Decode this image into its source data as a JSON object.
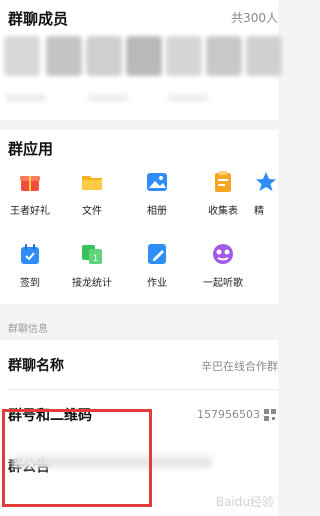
{
  "members": {
    "title": "群聊成员",
    "count": "共300人",
    "avatar_colors": [
      "#d8d8d8",
      "#c4c4c4",
      "#cfcfcf",
      "#b9b9b9",
      "#d6d6d6",
      "#c8c8c8",
      "#d0d0d0"
    ]
  },
  "apps": {
    "title": "群应用",
    "items": [
      {
        "label": "王者好礼",
        "icon": "gift-icon",
        "color": "#f24d3d"
      },
      {
        "label": "文件",
        "icon": "folder-icon",
        "color": "#f5b320"
      },
      {
        "label": "相册",
        "icon": "album-icon",
        "color": "#2f8ef5"
      },
      {
        "label": "收集表",
        "icon": "clipboard-icon",
        "color": "#f5a623"
      },
      {
        "label": "精",
        "icon": "star-icon",
        "color": "#2f8ef5"
      },
      {
        "label": "签到",
        "icon": "calendar-icon",
        "color": "#2f8ef5"
      },
      {
        "label": "接龙统计",
        "icon": "chain-icon",
        "color": "#39c25a"
      },
      {
        "label": "作业",
        "icon": "homework-icon",
        "color": "#2f8ef5"
      },
      {
        "label": "一起听歌",
        "icon": "music-icon",
        "color": "#a25ae6"
      }
    ]
  },
  "info": {
    "section_label": "群聊信息",
    "group_name_label": "群聊名称",
    "group_name_value": "辛巴在线合作群",
    "group_number_label": "群号和二维码",
    "group_number_value": "157956503",
    "announcement_label": "群公告"
  },
  "watermark": "Baidu经验"
}
